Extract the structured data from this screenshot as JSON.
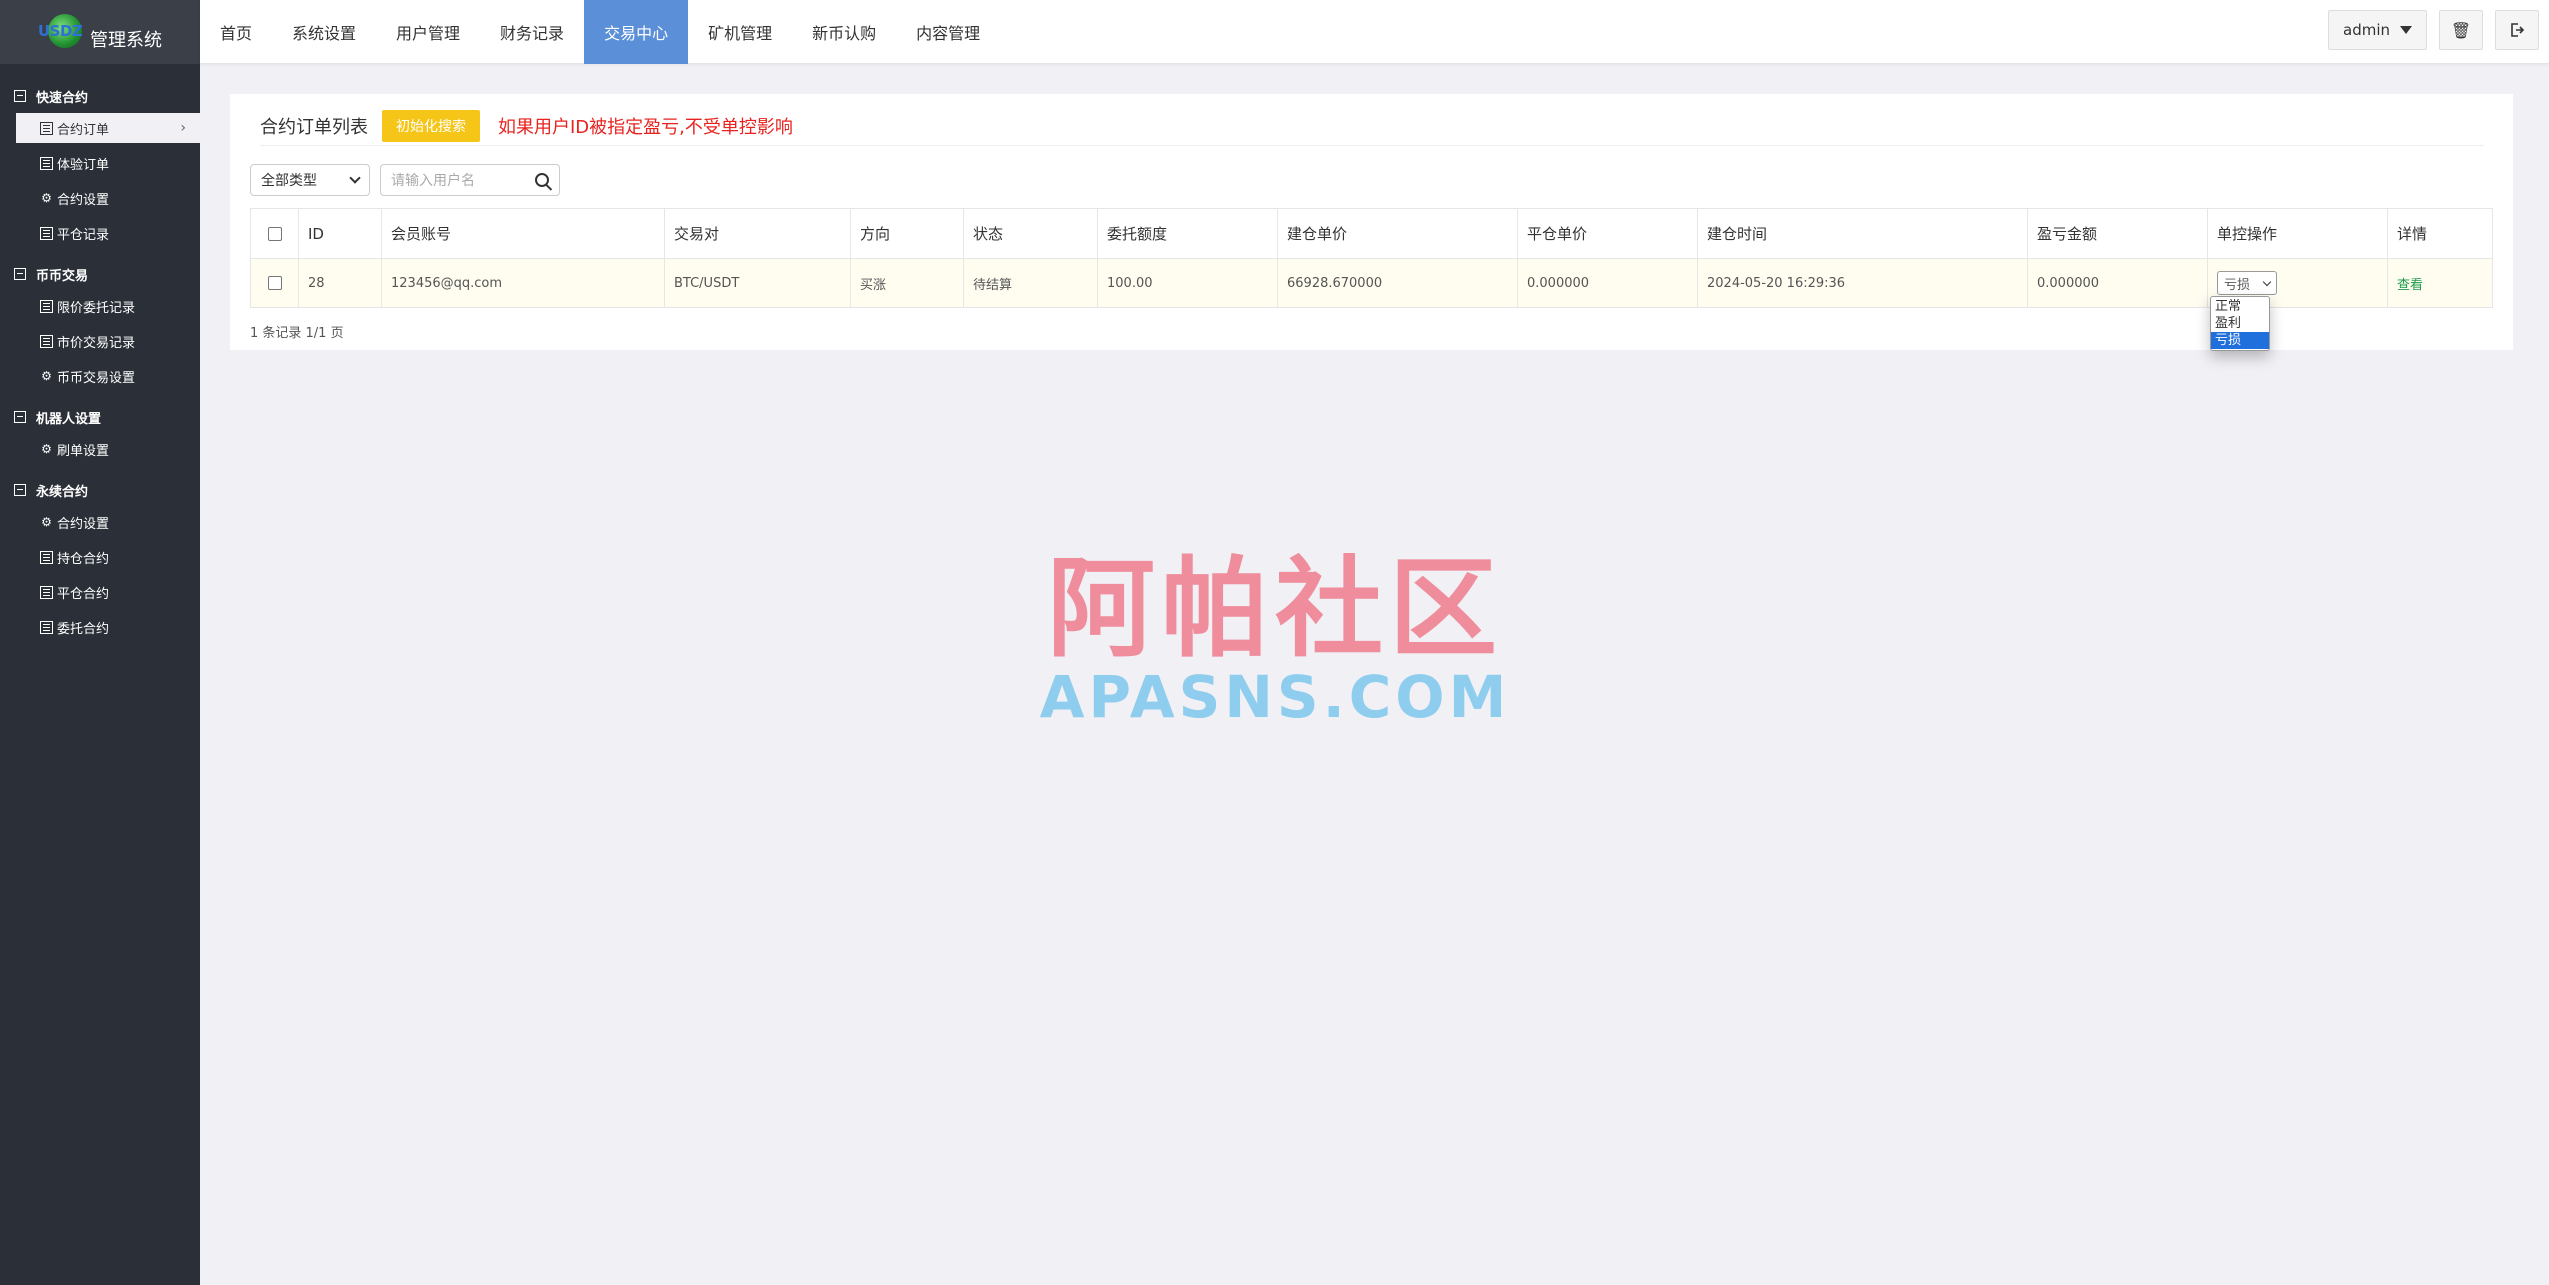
{
  "app": {
    "logo_text": "USDZ",
    "title": "管理系统"
  },
  "sidebar": {
    "groups": [
      {
        "label": "快速合约",
        "items": [
          {
            "label": "合约订单",
            "icon": "list-icon",
            "active": true
          },
          {
            "label": "体验订单",
            "icon": "list-icon"
          },
          {
            "label": "合约设置",
            "icon": "gear-icon"
          },
          {
            "label": "平仓记录",
            "icon": "list-icon"
          }
        ]
      },
      {
        "label": "币币交易",
        "items": [
          {
            "label": "限价委托记录",
            "icon": "list-icon"
          },
          {
            "label": "市价交易记录",
            "icon": "list-icon"
          },
          {
            "label": "币币交易设置",
            "icon": "gear-icon"
          }
        ]
      },
      {
        "label": "机器人设置",
        "items": [
          {
            "label": "刷单设置",
            "icon": "gear-icon"
          }
        ]
      },
      {
        "label": "永续合约",
        "items": [
          {
            "label": "合约设置",
            "icon": "gear-icon"
          },
          {
            "label": "持仓合约",
            "icon": "list-icon"
          },
          {
            "label": "平仓合约",
            "icon": "list-icon"
          },
          {
            "label": "委托合约",
            "icon": "list-icon"
          }
        ]
      }
    ]
  },
  "topnav": {
    "items": [
      "首页",
      "系统设置",
      "用户管理",
      "财务记录",
      "交易中心",
      "矿机管理",
      "新币认购",
      "内容管理"
    ],
    "active": "交易中心",
    "user": "admin"
  },
  "panel": {
    "title": "合约订单列表",
    "init_button": "初始化搜索",
    "warning": "如果用户ID被指定盈亏,不受单控影响"
  },
  "filters": {
    "type_select": "全部类型",
    "search_placeholder": "请输入用户名"
  },
  "table": {
    "headers": [
      "ID",
      "会员账号",
      "交易对",
      "方向",
      "状态",
      "委托额度",
      "建仓单价",
      "平仓单价",
      "建仓时间",
      "盈亏金额",
      "单控操作",
      "详情"
    ],
    "rows": [
      {
        "id": "28",
        "account": "123456@qq.com",
        "pair": "BTC/USDT",
        "direction": "买涨",
        "status": "待结算",
        "amount": "100.00",
        "open_price": "66928.670000",
        "close_price": "0.000000",
        "open_time": "2024-05-20 16:29:36",
        "pnl": "0.000000",
        "control": "亏损",
        "detail": "查看"
      }
    ]
  },
  "control_dropdown": {
    "options": [
      "正常",
      "盈利",
      "亏损"
    ],
    "selected": "亏损"
  },
  "pager": "1 条记录 1/1 页",
  "watermark": {
    "cn": "阿帕社区",
    "en": "APASNS.COM"
  },
  "colors": {
    "sidebar": "#2b3038",
    "active_nav": "#5b90d8",
    "init_button": "#f5c518",
    "warning": "#e8231f",
    "buy": "#2bb24c"
  }
}
